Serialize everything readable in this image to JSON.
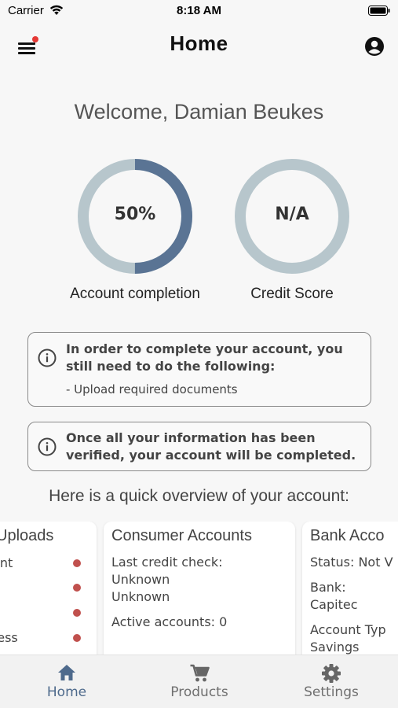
{
  "status_bar": {
    "carrier": "Carrier",
    "time": "8:18 AM"
  },
  "app_bar": {
    "title": "Home"
  },
  "welcome": "Welcome, Damian Beukes",
  "gauges": {
    "completion": {
      "value_text": "50%",
      "progress": 0.5,
      "label": "Account completion"
    },
    "credit": {
      "value_text": "N/A",
      "progress": 0,
      "label": "Credit Score"
    }
  },
  "colors": {
    "gauge_fill": "#5a7494",
    "gauge_track": "#b7c6cc",
    "accent": "#4e6a8c",
    "status_dot": "#c0504d"
  },
  "info": {
    "box1_line1": "In order to complete your account, you",
    "box1_line2": "still need to do the following:",
    "box1_item": "- Upload required documents",
    "box2_line1": "Once all your information has been",
    "box2_line2": "verified, your account will be completed."
  },
  "overview_heading": "Here is a quick overview of your account:",
  "cards": {
    "uploads": {
      "title": "Uploads",
      "items": [
        "ent",
        "",
        "",
        "ress"
      ]
    },
    "consumer": {
      "title": "Consumer Accounts",
      "last_check_label": "Last credit check:",
      "line2": "Unknown",
      "line3": "Unknown",
      "active": "Active accounts: 0"
    },
    "bank": {
      "title": "Bank Acco",
      "status": "Status: Not V",
      "bank_label": "Bank:",
      "bank_value": "Capitec",
      "type_label": "Account Typ",
      "type_value": "Savings"
    }
  },
  "nav": {
    "home": "Home",
    "products": "Products",
    "settings": "Settings"
  },
  "icons": {
    "menu": "menu-icon",
    "account": "account-circle-icon",
    "info": "info-icon",
    "home": "home-icon",
    "cart": "cart-icon",
    "settings": "gear-icon"
  }
}
